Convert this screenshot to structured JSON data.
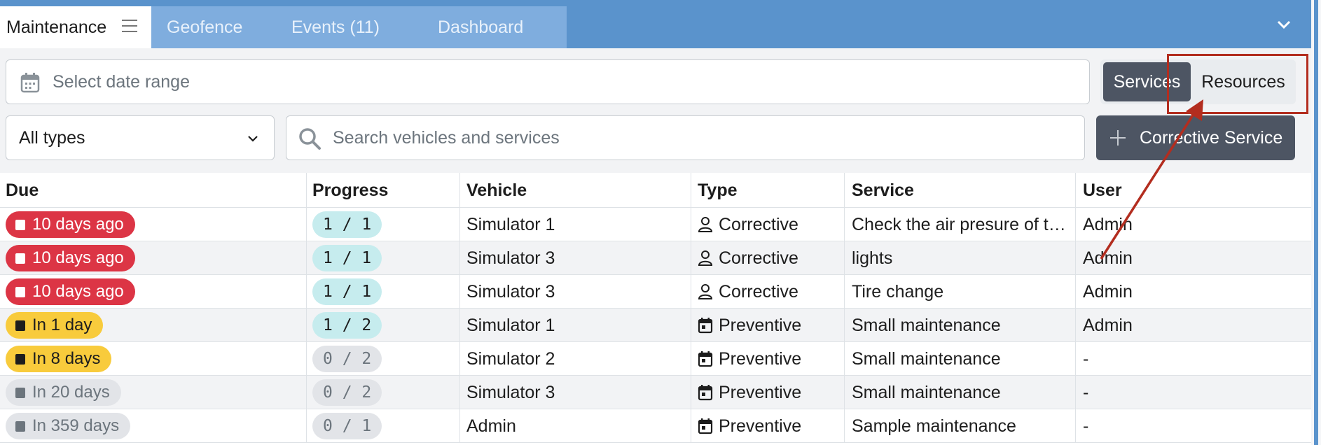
{
  "tabs": [
    {
      "label": "Maintenance",
      "active": true
    },
    {
      "label": "Geofence"
    },
    {
      "label": "Events (11)"
    },
    {
      "label": "Dashboard"
    }
  ],
  "filters": {
    "date_placeholder": "Select date range",
    "view_toggle": {
      "services": "Services",
      "resources": "Resources",
      "selected": "Services"
    },
    "type_select": "All types",
    "search_placeholder": "Search vehicles and services",
    "add_button": "Corrective Service"
  },
  "table": {
    "columns": [
      "Due",
      "Progress",
      "Vehicle",
      "Type",
      "Service",
      "User"
    ],
    "rows": [
      {
        "due": "10 days ago",
        "due_status": "overdue",
        "progress": "1 / 1",
        "vehicle": "Simulator 1",
        "type": "Corrective",
        "service": "Check the air presure of the tires",
        "user": "Admin"
      },
      {
        "due": "10 days ago",
        "due_status": "overdue",
        "progress": "1 / 1",
        "vehicle": "Simulator 3",
        "type": "Corrective",
        "service": "lights",
        "user": "Admin"
      },
      {
        "due": "10 days ago",
        "due_status": "overdue",
        "progress": "1 / 1",
        "vehicle": "Simulator 3",
        "type": "Corrective",
        "service": "Tire change",
        "user": "Admin"
      },
      {
        "due": "In 1 day",
        "due_status": "soon",
        "progress": "1 / 2",
        "vehicle": "Simulator 1",
        "type": "Preventive",
        "service": "Small maintenance",
        "user": "Admin"
      },
      {
        "due": "In 8 days",
        "due_status": "soon",
        "progress": "0 / 2",
        "vehicle": "Simulator 2",
        "type": "Preventive",
        "service": "Small maintenance",
        "user": "-"
      },
      {
        "due": "In 20 days",
        "due_status": "later",
        "progress": "0 / 2",
        "vehicle": "Simulator 3",
        "type": "Preventive",
        "service": "Small maintenance",
        "user": "-"
      },
      {
        "due": "In 359 days",
        "due_status": "later",
        "progress": "0 / 1",
        "vehicle": "Admin",
        "type": "Preventive",
        "service": "Sample maintenance",
        "user": "-"
      }
    ]
  },
  "icons": {
    "tab_menu": "hamburger-icon",
    "tab_collapse": "chevron-down-icon",
    "date": "calendar-icon",
    "search": "search-icon",
    "add": "plus-icon",
    "corrective_type": "person-icon",
    "preventive_type": "calendar-icon",
    "due": "calendar-icon"
  },
  "colors": {
    "tabbar": "#5a93cc",
    "overdue": "#dc3545",
    "soon": "#f8cb3c",
    "later": "#e2e4e8",
    "progress_done": "#c6ecee",
    "dark_button": "#4d5563",
    "annotation": "#b32d1f"
  }
}
